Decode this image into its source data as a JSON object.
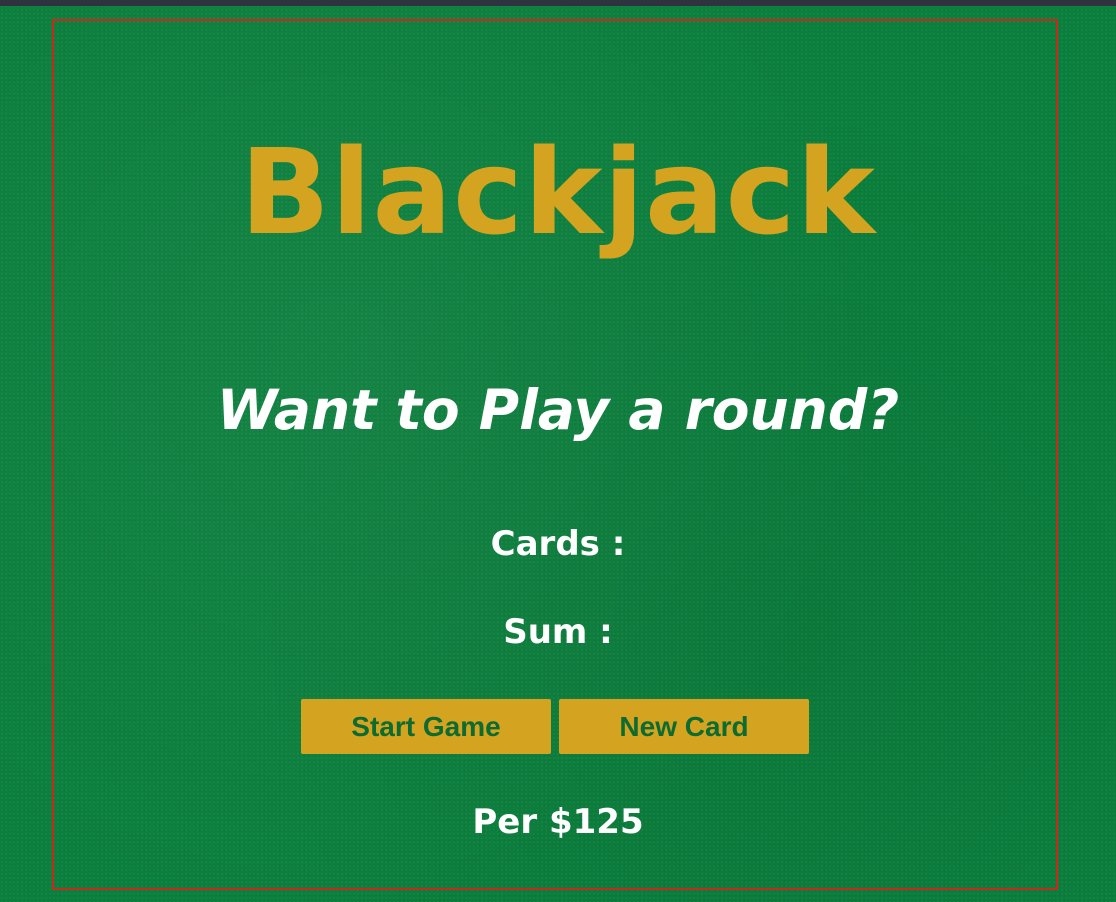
{
  "game": {
    "title": "Blackjack",
    "message": "Want to Play a round?",
    "cards_label": "Cards :",
    "sum_label": "Sum :"
  },
  "buttons": {
    "start_game": "Start Game",
    "new_card": "New Card"
  },
  "player": {
    "info": "Per $125"
  },
  "colors": {
    "table_felt": "#0b7f3d",
    "frame_border": "#c9281d",
    "gold": "#d4a31f",
    "button_text": "#0d6b32",
    "text": "#ffffff"
  }
}
